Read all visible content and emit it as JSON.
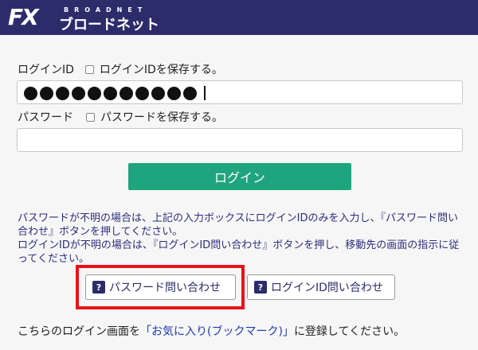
{
  "header": {
    "logo_fx": "FX",
    "logo_broadnet": "BROADNET",
    "logo_brand": "ブロードネット",
    "bg_color": "#2c2c6b"
  },
  "login_id": {
    "label": "ログインID",
    "save_label": "ログインIDを保存する。",
    "masked_value": "●●●●●●●●●●●"
  },
  "password": {
    "label": "パスワード",
    "save_label": "パスワードを保存する。",
    "value": ""
  },
  "login_button": {
    "label": "ログイン",
    "color": "#1fa57e"
  },
  "help": {
    "line1": "パスワードが不明の場合は、上記の入力ボックスにログインIDのみを入力し、『パスワード問い合わせ』ボタンを押してください。",
    "line2": "ログインIDが不明の場合は、『ログインID問い合わせ』ボタンを押し、移動先の画面の指示に従ってください。"
  },
  "buttons": {
    "password_inquiry": "パスワード問い合わせ",
    "login_id_inquiry": "ログインID問い合わせ",
    "question_glyph": "?"
  },
  "footer": {
    "prefix": "こちらのログイン画面を",
    "link": "「お気に入り(ブックマーク)」",
    "suffix": "に登録してください。"
  },
  "highlight_color": "#e8131a"
}
